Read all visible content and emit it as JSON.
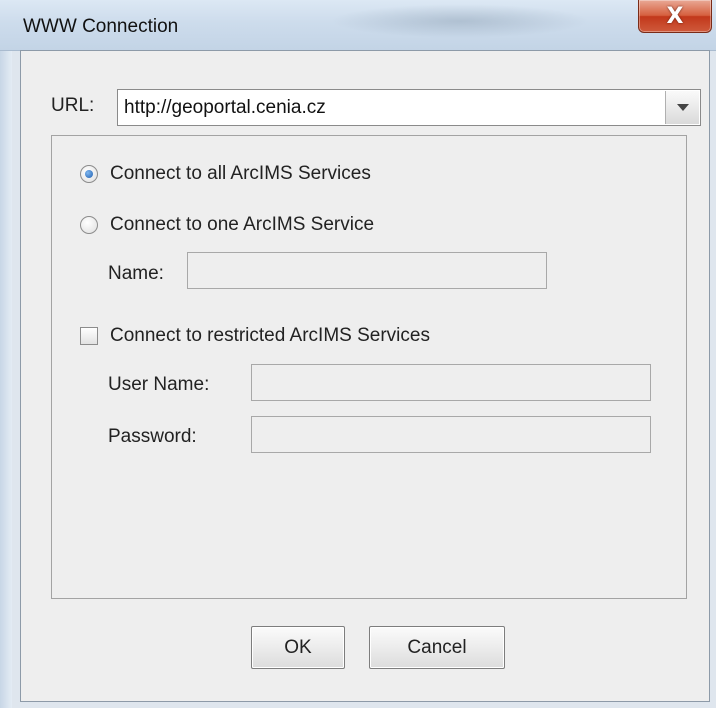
{
  "window": {
    "title": "WWW Connection",
    "close_glyph": "X"
  },
  "url": {
    "label": "URL:",
    "value": "http://geoportal.cenia.cz"
  },
  "options": {
    "all_services": {
      "label": "Connect to all ArcIMS Services",
      "selected": true
    },
    "one_service": {
      "label": "Connect to one ArcIMS Service",
      "selected": false
    },
    "name_label": "Name:",
    "name_value": "",
    "restricted": {
      "label": "Connect to restricted ArcIMS Services",
      "checked": false
    },
    "user_name_label": "User Name:",
    "user_name_value": "",
    "password_label": "Password:",
    "password_value": ""
  },
  "buttons": {
    "ok": "OK",
    "cancel": "Cancel"
  },
  "icons": {
    "close": "close-icon",
    "dropdown": "chevron-down-icon"
  },
  "colors": {
    "title_bar": "#cddcec",
    "close_button": "#c2381b",
    "dialog_background": "#eeeeee",
    "radio_selected": "#1f5fb0"
  }
}
